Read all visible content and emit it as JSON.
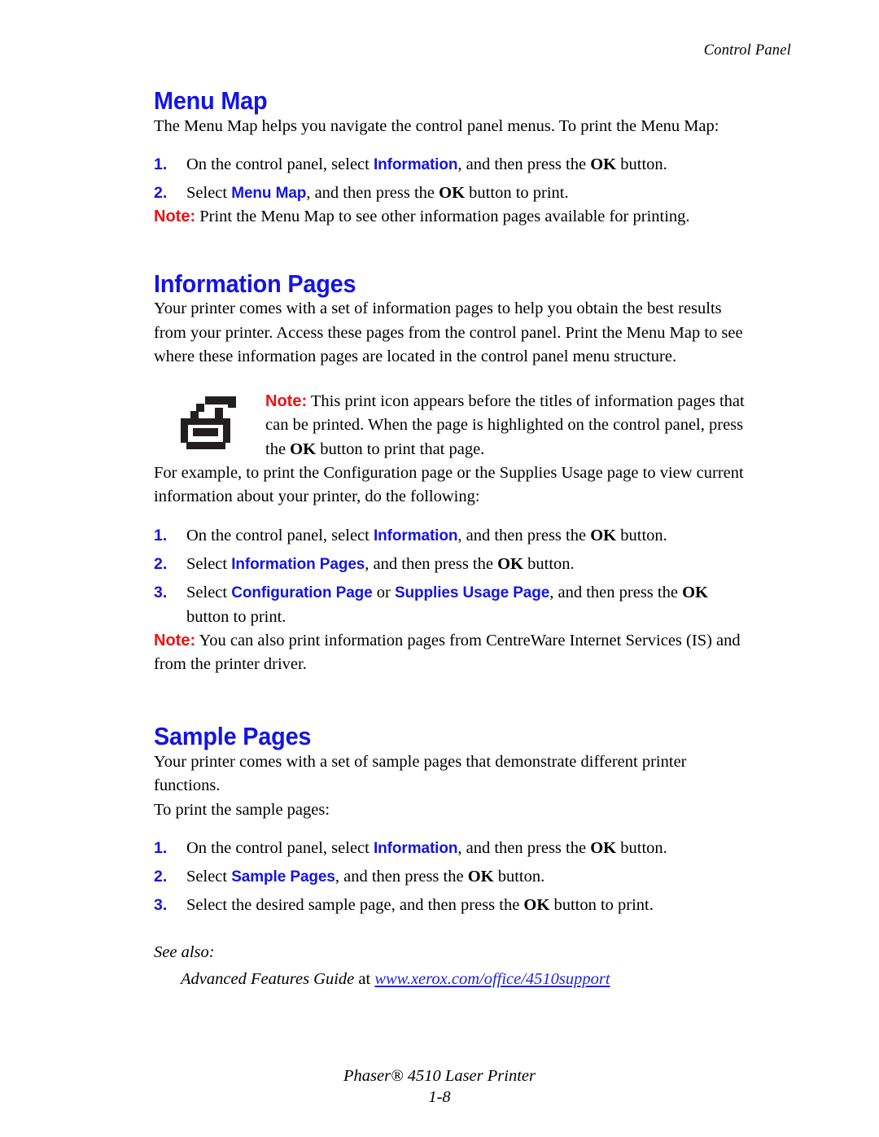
{
  "header": {
    "running_head": "Control Panel"
  },
  "sections": {
    "menu_map": {
      "heading": "Menu Map",
      "intro": "The Menu Map helps you navigate the control panel menus. To print the Menu Map:",
      "steps": [
        {
          "num": "1.",
          "pre": "On the control panel, select ",
          "ui1": "Information",
          "mid": ", and then press the ",
          "ok": "OK",
          "post": " button."
        },
        {
          "num": "2.",
          "pre": "Select ",
          "ui1": "Menu Map",
          "mid": ", and then press the ",
          "ok": "OK",
          "post": " button to print."
        }
      ],
      "note": {
        "label": "Note:",
        "text": " Print the Menu Map to see other information pages available for printing."
      }
    },
    "information_pages": {
      "heading": "Information Pages",
      "intro": "Your printer comes with a set of information pages to help you obtain the best results from your printer. Access these pages from the control panel. Print the Menu Map to see where these information pages are located in the control panel menu structure.",
      "icon_note": {
        "icon": "printer-icon",
        "label": "Note:",
        "text_before_ok": " This print icon appears before the titles of information pages that can be printed. When the page is highlighted on the control panel, press the ",
        "ok": "OK",
        "text_after_ok": " button to print that page."
      },
      "example_intro": "For example, to print the Configuration page or the Supplies Usage page to view current information about your printer, do the following:",
      "steps": [
        {
          "num": "1.",
          "pre": "On the control panel, select ",
          "ui1": "Information",
          "mid": ", and then press the ",
          "ok": "OK",
          "post": " button."
        },
        {
          "num": "2.",
          "pre": "Select ",
          "ui1": "Information Pages",
          "mid": ", and then press the ",
          "ok": "OK",
          "post": " button."
        },
        {
          "num": "3.",
          "pre": "Select ",
          "ui1": "Configuration Page",
          "conj": " or ",
          "ui2": "Supplies Usage Page",
          "mid": ", and then press the ",
          "ok": "OK",
          "post": " button to print."
        }
      ],
      "note": {
        "label": "Note:",
        "text": " You can also print information pages from CentreWare Internet Services (IS) and from the printer driver."
      }
    },
    "sample_pages": {
      "heading": "Sample Pages",
      "intro": "Your printer comes with a set of sample pages that demonstrate different printer functions.",
      "intro2": "To print the sample pages:",
      "steps": [
        {
          "num": "1.",
          "pre": "On the control panel, select ",
          "ui1": "Information",
          "mid": ", and then press the ",
          "ok": "OK",
          "post": " button."
        },
        {
          "num": "2.",
          "pre": "Select ",
          "ui1": "Sample Pages",
          "mid": ", and then press the ",
          "ok": "OK",
          "post": " button."
        },
        {
          "num": "3.",
          "pre": "Select the desired sample page, and then press the ",
          "ok": "OK",
          "post": " button to print."
        }
      ],
      "see_also": {
        "label": "See also:",
        "ref_title": "Advanced Features Guide",
        "ref_at": " at ",
        "ref_url": "www.xerox.com/office/4510support"
      }
    }
  },
  "footer": {
    "product": "Phaser® 4510 Laser Printer",
    "page_number": "1-8"
  },
  "colors": {
    "heading_blue": "#1414e6",
    "ui_blue": "#1414e6",
    "note_red": "#ee1111",
    "link_blue": "#2222dd",
    "icon_dark": "#231f20"
  }
}
